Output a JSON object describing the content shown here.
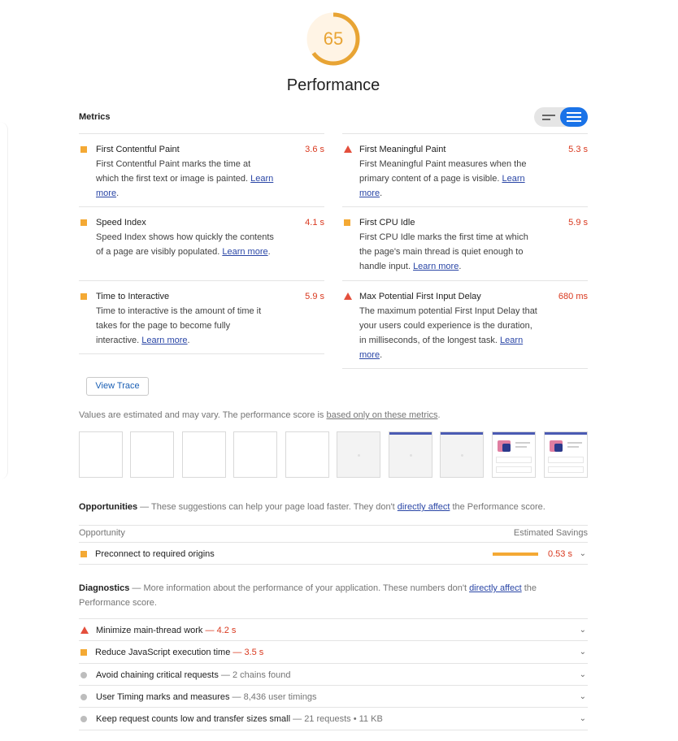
{
  "gauge": {
    "score": "65",
    "score_fraction": 0.65,
    "color": "#e8a434"
  },
  "title": "Performance",
  "metrics_header": "Metrics",
  "metrics": {
    "left": [
      {
        "indicator": "square",
        "title": "First Contentful Paint",
        "value": "3.6 s",
        "desc": "First Contentful Paint marks the time at which the first text or image is painted.",
        "link": "Learn more"
      },
      {
        "indicator": "square",
        "title": "Speed Index",
        "value": "4.1 s",
        "desc": "Speed Index shows how quickly the contents of a page are visibly populated.",
        "link": "Learn more"
      },
      {
        "indicator": "square",
        "title": "Time to Interactive",
        "value": "5.9 s",
        "desc": "Time to interactive is the amount of time it takes for the page to become fully interactive.",
        "link": "Learn more"
      }
    ],
    "right": [
      {
        "indicator": "triangle",
        "title": "First Meaningful Paint",
        "value": "5.3 s",
        "desc": "First Meaningful Paint measures when the primary content of a page is visible.",
        "link": "Learn more"
      },
      {
        "indicator": "square",
        "title": "First CPU Idle",
        "value": "5.9 s",
        "desc": "First CPU Idle marks the first time at which the page's main thread is quiet enough to handle input.",
        "link": "Learn more"
      },
      {
        "indicator": "triangle",
        "title": "Max Potential First Input Delay",
        "value": "680 ms",
        "desc": "The maximum potential First Input Delay that your users could experience is the duration, in milliseconds, of the longest task.",
        "link": "Learn more"
      }
    ]
  },
  "view_trace": "View Trace",
  "estimated": {
    "text": "Values are estimated and may vary. The performance score is ",
    "link": "based only on these metrics",
    "end": "."
  },
  "opportunities": {
    "title": "Opportunities",
    "dash": " — ",
    "desc": "These suggestions can help your page load faster. They don't ",
    "link": "directly affect",
    "desc_end": " the Performance score.",
    "col_left": "Opportunity",
    "col_right": "Estimated Savings",
    "items": [
      {
        "title": "Preconnect to required origins",
        "value": "0.53 s"
      }
    ]
  },
  "diagnostics": {
    "title": "Diagnostics",
    "dash": " — ",
    "desc": "More information about the performance of your application. These numbers don't ",
    "link": "directly affect",
    "desc_end": " the Performance score.",
    "items": [
      {
        "indicator": "triangle",
        "title": "Minimize main-thread work",
        "sep": " — ",
        "value": "4.2 s"
      },
      {
        "indicator": "square",
        "title": "Reduce JavaScript execution time",
        "sep": " — ",
        "value": "3.5 s"
      },
      {
        "indicator": "circle",
        "title": "Avoid chaining critical requests",
        "sep": " — ",
        "value": "2 chains found"
      },
      {
        "indicator": "circle",
        "title": "User Timing marks and measures",
        "sep": " — ",
        "value": "8,436 user timings"
      },
      {
        "indicator": "circle",
        "title": "Keep request counts low and transfer sizes small",
        "sep": " — ",
        "value": "21 requests • 11 KB"
      }
    ]
  },
  "chevron": "⌄",
  "colors": {
    "average": "#f4a934",
    "fail": "#e44f3c",
    "fail_text": "#d9381e",
    "link": "#2a46a6",
    "toggle_active": "#1a73e8"
  }
}
